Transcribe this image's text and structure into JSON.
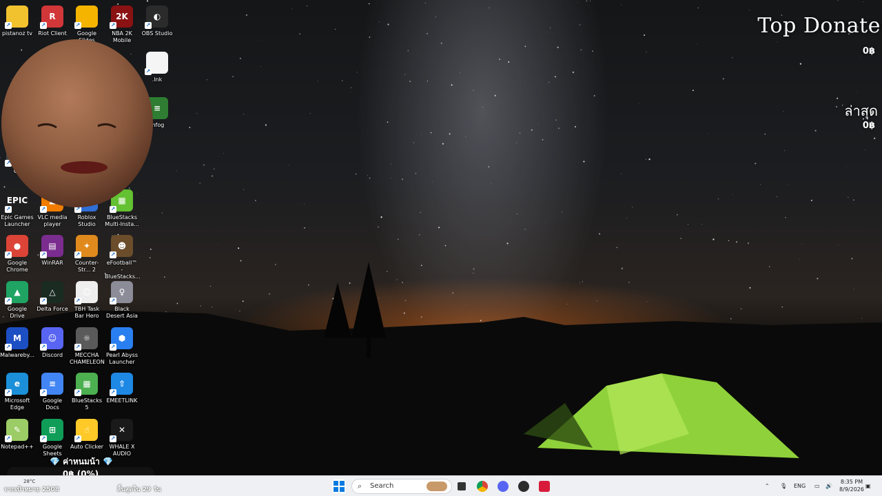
{
  "desktop": {
    "icons": [
      {
        "label": "pistanoz tv",
        "icon": "folder-icon",
        "color": "#f2c12e",
        "glyph": ""
      },
      {
        "label": "Riot Client",
        "icon": "riot-client-icon",
        "color": "#d13639",
        "glyph": "R"
      },
      {
        "label": "Google Slides",
        "icon": "google-slides-icon",
        "color": "#f4b400",
        "glyph": ""
      },
      {
        "label": "NBA 2K Mobile",
        "icon": "nba-2k-icon",
        "color": "#8a1212",
        "glyph": "2K"
      },
      {
        "label": "OBS Studio",
        "icon": "obs-icon",
        "color": "#2b2b2b",
        "glyph": "◐"
      },
      {
        "label": ".lnk",
        "icon": "file-icon",
        "color": "#f5f5f5",
        "glyph": ""
      },
      {
        "label": "mfog",
        "icon": "app-icon",
        "color": "#2e7d32",
        "glyph": "≡"
      },
      {
        "label": "Co",
        "icon": "app-icon",
        "color": "#444444",
        "glyph": ""
      },
      {
        "label": "Epic Games Launcher",
        "icon": "epic-games-icon",
        "color": "#1f1f1f",
        "glyph": "EPIC"
      },
      {
        "label": "VLC media player",
        "icon": "vlc-icon",
        "color": "#f07c00",
        "glyph": "▲"
      },
      {
        "label": "Roblox Studio",
        "icon": "roblox-studio-icon",
        "color": "#2f6fd6",
        "glyph": "◆"
      },
      {
        "label": "BlueStacks Multi-Insta...",
        "icon": "bluestacks-multi-icon",
        "color": "#63c132",
        "glyph": "▦"
      },
      {
        "label": "Google Chrome",
        "icon": "chrome-icon",
        "color": "#db4437",
        "glyph": "●"
      },
      {
        "label": "WinRAR",
        "icon": "winrar-icon",
        "color": "#7b2c8f",
        "glyph": "▤"
      },
      {
        "label": "Counter-Str... 2",
        "icon": "counter-strike-icon",
        "color": "#e08a1e",
        "glyph": "✦"
      },
      {
        "label": "eFootball™ - BlueStacks...",
        "icon": "efootball-icon",
        "color": "#6b4d2c",
        "glyph": "☻"
      },
      {
        "label": "Google Drive",
        "icon": "google-drive-icon",
        "color": "#1fa463",
        "glyph": "▲"
      },
      {
        "label": "Delta Force",
        "icon": "delta-force-icon",
        "color": "#1a2b22",
        "glyph": "△"
      },
      {
        "label": "TBH Task Bar Hero",
        "icon": "tbh-icon",
        "color": "#eeeeee",
        "glyph": "☺"
      },
      {
        "label": "Black Desert Asia",
        "icon": "black-desert-icon",
        "color": "#8c8c99",
        "glyph": "♀"
      },
      {
        "label": "Malwareby...",
        "icon": "malwarebytes-icon",
        "color": "#1d4fc4",
        "glyph": "M"
      },
      {
        "label": "Discord",
        "icon": "discord-icon",
        "color": "#5865f2",
        "glyph": "☺"
      },
      {
        "label": "MECCHA CHAMELEON",
        "icon": "meccha-icon",
        "color": "#5a5a5a",
        "glyph": "☼"
      },
      {
        "label": "Pearl Abyss Launcher",
        "icon": "pearl-abyss-icon",
        "color": "#2a7ff0",
        "glyph": "⬢"
      },
      {
        "label": "Microsoft Edge",
        "icon": "edge-icon",
        "color": "#1b8fd8",
        "glyph": "e"
      },
      {
        "label": "Google Docs",
        "icon": "google-docs-icon",
        "color": "#4285f4",
        "glyph": "≡"
      },
      {
        "label": "BlueStacks 5",
        "icon": "bluestacks-icon",
        "color": "#4caf50",
        "glyph": "▦"
      },
      {
        "label": "EMEETLINK",
        "icon": "emeetlink-icon",
        "color": "#1e88e5",
        "glyph": "⇧"
      },
      {
        "label": "Notepad++",
        "icon": "notepad-plus-plus-icon",
        "color": "#9ccc65",
        "glyph": "✎"
      },
      {
        "label": "Google Sheets",
        "icon": "google-sheets-icon",
        "color": "#0f9d58",
        "glyph": "⊞"
      },
      {
        "label": "Auto Clicker",
        "icon": "auto-clicker-icon",
        "color": "#ffca28",
        "glyph": "☝"
      },
      {
        "label": "WHALE X AUDIO",
        "icon": "whale-audio-icon",
        "color": "#1a1a1a",
        "glyph": "✕"
      }
    ]
  },
  "overlay": {
    "top_donate_title": "Top Donate",
    "top_donate_amount": "0฿",
    "latest_title": "ล่าสุด",
    "latest_amount": "0฿",
    "goal_title": "💎 ค่าหนมน้า 💎",
    "goal_progress_text": "0฿ (0%)",
    "goal_progress": 0,
    "goal_from": "จากเป้าหมาย 2508",
    "goal_ends": "สิ้นสุดใน 29 วัน"
  },
  "taskbar": {
    "weather": "28°C",
    "search_placeholder": "Search",
    "language": "ENG",
    "time": "8:35 PM",
    "date": "8/9/2026"
  }
}
